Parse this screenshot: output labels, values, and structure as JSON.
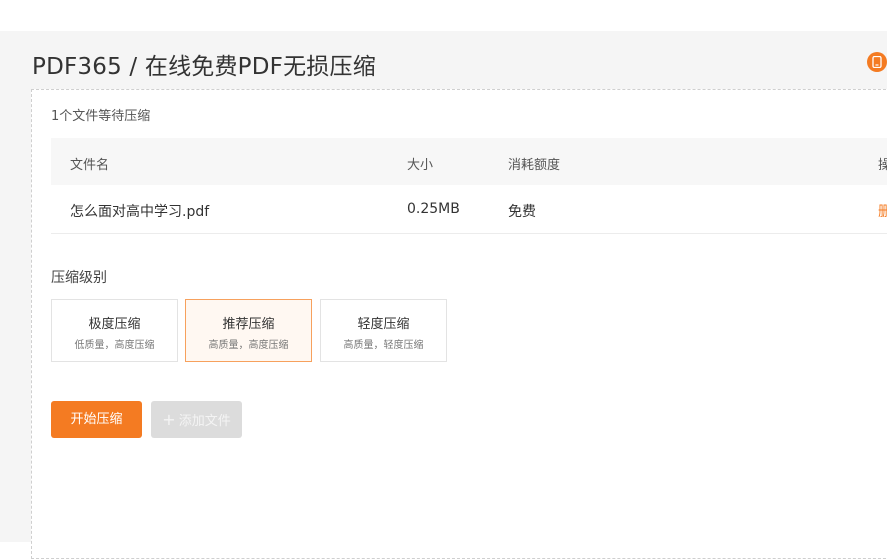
{
  "header": {
    "title": "PDF365 / 在线免费PDF无损压缩",
    "corner_icon": "mobile-icon"
  },
  "file_list": {
    "status": "1个文件等待压缩",
    "columns": [
      "文件名",
      "大小",
      "消耗额度",
      "操"
    ],
    "rows": [
      {
        "name": "怎么面对高中学习.pdf",
        "size": "0.25MB",
        "quota": "免费",
        "action": "删"
      }
    ]
  },
  "compression": {
    "label": "压缩级别",
    "options": [
      {
        "title": "极度压缩",
        "subtitle": "低质量，高度压缩",
        "selected": false
      },
      {
        "title": "推荐压缩",
        "subtitle": "高质量，高度压缩",
        "selected": true
      },
      {
        "title": "轻度压缩",
        "subtitle": "高质量，轻度压缩",
        "selected": false
      }
    ]
  },
  "actions": {
    "start": "开始压缩",
    "add_file": "添加文件"
  },
  "colors": {
    "accent": "#f47b22",
    "disabled": "#dcdcdc",
    "page_bg": "#f5f5f5"
  }
}
